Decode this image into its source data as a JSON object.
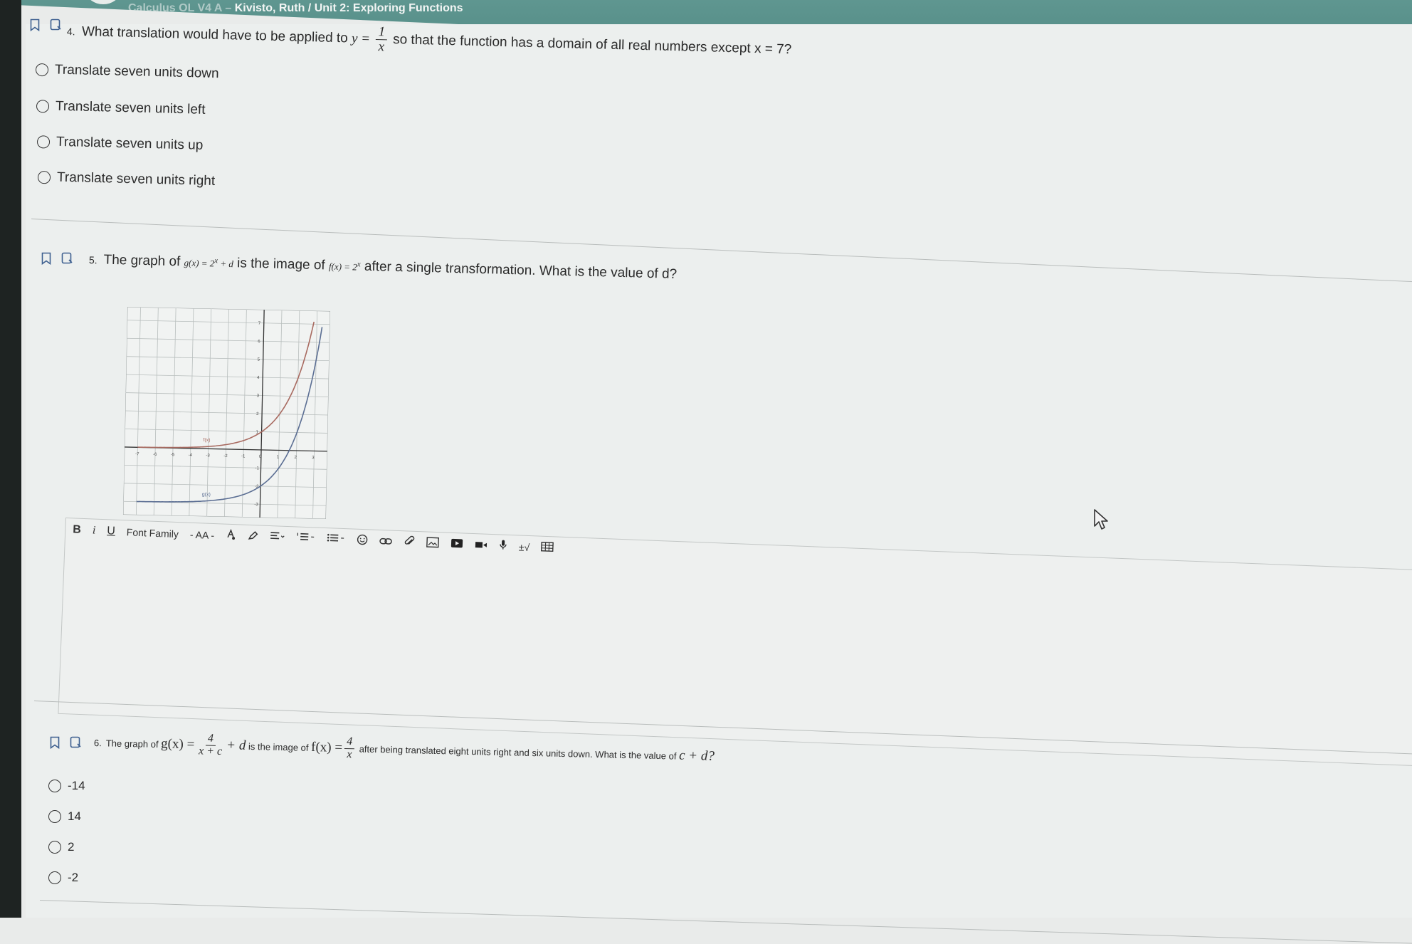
{
  "header": {
    "title_prefix": "Calculus OL V4 A – ",
    "title": "Kivisto, Ruth / Unit 2: Exploring Functions"
  },
  "q4": {
    "number": "4.",
    "text_before": "What translation would have to be applied to",
    "y_eq": "y =",
    "frac_num": "1",
    "frac_den": "x",
    "text_after": "so that the function has a domain of all real numbers except",
    "condition": "x = 7?",
    "options": [
      "Translate seven units down",
      "Translate seven units left",
      "Translate seven units up",
      "Translate seven units right"
    ]
  },
  "q5": {
    "number": "5.",
    "text1": "The graph of",
    "gx": "g(x) = 2",
    "gx_exp": "x",
    "gx_tail": " + d",
    "text2": "is the image of",
    "fx": "f(x) = 2",
    "fx_exp": "x",
    "text3": "after a single transformation.  What is the value of d?"
  },
  "chart_data": {
    "type": "line",
    "series": [
      {
        "name": "f(x)",
        "color": "#a86a60",
        "x": [
          -7,
          -4,
          -2,
          0,
          1,
          2,
          3
        ],
        "y": [
          0.0,
          0.06,
          0.25,
          1,
          2,
          4,
          8
        ]
      },
      {
        "name": "g(x)",
        "color": "#5b6e93",
        "x": [
          -7,
          -4,
          -2,
          0,
          1,
          2,
          3.3
        ],
        "y": [
          -3.0,
          -2.94,
          -2.75,
          -2,
          -1,
          1,
          6.8
        ]
      }
    ],
    "series_labels": [
      "f(x)",
      "g(x)"
    ],
    "x_ticks": [
      "-7",
      "-6",
      "-5",
      "-4",
      "-3",
      "-2",
      "-1",
      "0",
      "1",
      "2",
      "3"
    ],
    "y_ticks": [
      "7",
      "6",
      "5",
      "4",
      "3",
      "2",
      "1",
      "-1",
      "-2",
      "-3"
    ],
    "xlim": [
      -7.5,
      3.5
    ],
    "ylim": [
      -3.5,
      7.5
    ],
    "grid": true
  },
  "editor": {
    "bold": "B",
    "italic": "i",
    "underline": "U",
    "font_family": "Font Family",
    "font_size": "AA",
    "formula": "±√"
  },
  "q6": {
    "number": "6.",
    "text1": "The graph of",
    "g_label": "g(x) =",
    "g_num": "4",
    "g_den": "x + c",
    "g_tail": "+ d",
    "text2": "is the image of",
    "f_label": "f(x) =",
    "f_num": "4",
    "f_den": "x",
    "text3": "after being translated eight  units right and six units down.  What is the value of",
    "target": "c + d?",
    "options": [
      "-14",
      "14",
      "2",
      "-2"
    ]
  }
}
